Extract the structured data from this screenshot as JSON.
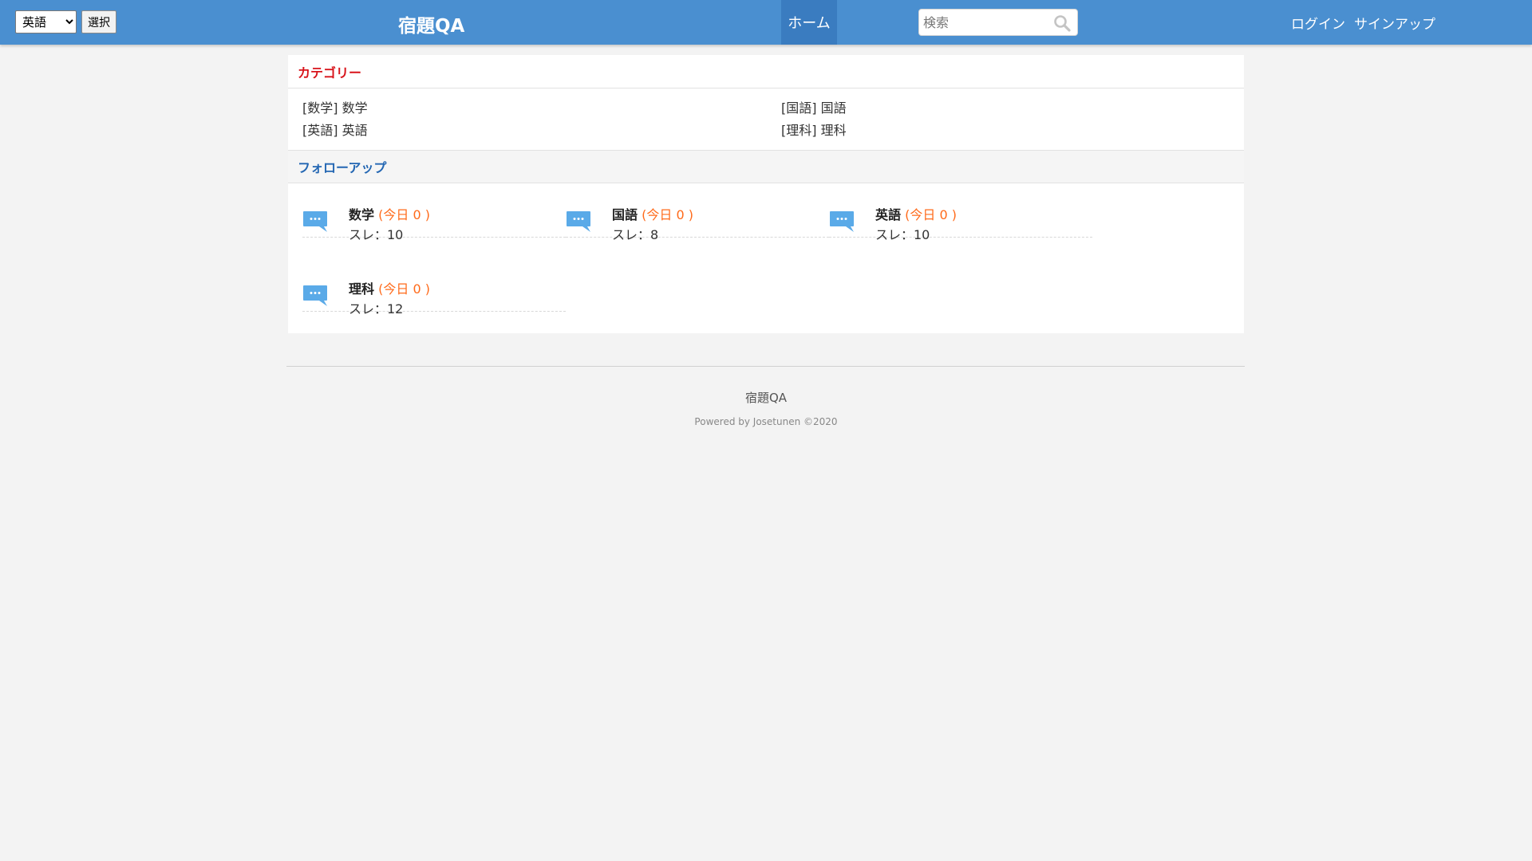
{
  "header": {
    "language_selected": "英語",
    "language_options": [
      "英語"
    ],
    "select_button_label": "選択",
    "brand": "宿題QA",
    "nav_home": "ホーム",
    "search_placeholder": "検索",
    "login": "ログイン",
    "signup": "サインアップ"
  },
  "categories": {
    "title": "カテゴリー",
    "items": [
      {
        "label": "[数学] 数学"
      },
      {
        "label": "[国語] 国語"
      },
      {
        "label": "[英語] 英語"
      },
      {
        "label": "[理科] 理科"
      }
    ]
  },
  "followup": {
    "title": "フォローアップ",
    "forums": [
      {
        "name": "数学",
        "today": "(今日 0 )",
        "threads": "スレ：10"
      },
      {
        "name": "国語",
        "today": "(今日 0 )",
        "threads": "スレ：8"
      },
      {
        "name": "英語",
        "today": "(今日 0 )",
        "threads": "スレ：10"
      },
      {
        "name": "理科",
        "today": "(今日 0 )",
        "threads": "スレ：12"
      }
    ]
  },
  "footer": {
    "name": "宿題QA",
    "powered": "Powered by Josetunen ©2020"
  },
  "colors": {
    "header_bg": "#4a8fd0",
    "nav_active": "#3a7cc0",
    "category_title": "#d8141b",
    "followup_title": "#2467b3",
    "today_count": "#ff6a1a",
    "forum_icon": "#5aaae8"
  }
}
